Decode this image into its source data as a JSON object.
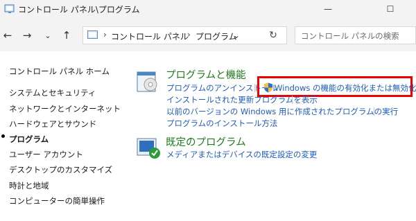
{
  "window": {
    "title": "コントロール パネル\\プログラム"
  },
  "address": {
    "crumbs": [
      "コントロール パネル",
      "プログラム"
    ]
  },
  "search": {
    "placeholder": "コントロール パネルの検索"
  },
  "sidebar": {
    "home": "コントロール パネル ホーム",
    "items": [
      {
        "label": "システムとセキュリティ"
      },
      {
        "label": "ネットワークとインターネット"
      },
      {
        "label": "ハードウェアとサウンド"
      },
      {
        "label": "プログラム",
        "active": true
      },
      {
        "label": "ユーザー アカウント"
      },
      {
        "label": "デスクトップのカスタマイズ"
      },
      {
        "label": "時計と地域"
      },
      {
        "label": "コンピューターの簡単操作"
      }
    ]
  },
  "main": {
    "programs": {
      "title": "プログラムと機能",
      "links": {
        "uninstall": "プログラムのアンインストール",
        "features": "Windows の機能の有効化または無効化",
        "updates": "インストールされた更新プログラムを表示",
        "compat": "以前のバージョンの Windows 用に作成されたプログラムの実行",
        "howto": "プログラムのインストール方法"
      }
    },
    "defaults": {
      "title": "既定のプログラム",
      "links": {
        "settings": "メディアまたはデバイスの既定設定の変更"
      }
    }
  },
  "colors": {
    "link": "#1f5bbf",
    "category_title": "#1e7a1e",
    "highlight_border": "#e00000"
  },
  "icons": {
    "title": "control-panel-icon",
    "back": "arrow-left-icon",
    "forward": "arrow-right-icon",
    "recent": "chevron-down-icon",
    "up": "arrow-up-icon",
    "refresh": "refresh-icon",
    "programs": "programs-disc-icon",
    "defaults": "default-programs-icon",
    "uac": "uac-shield-icon"
  }
}
